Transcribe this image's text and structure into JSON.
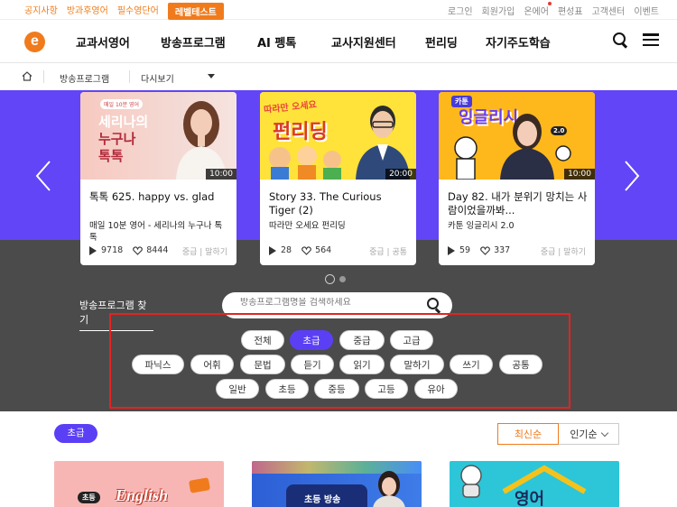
{
  "topbar": {
    "left_links": [
      "공지사항",
      "방과후영어",
      "필수영단어"
    ],
    "level_test": "레벨테스트",
    "right_links": [
      "로그인",
      "회원가입",
      "온에어",
      "편성표",
      "고객센터",
      "이벤트"
    ]
  },
  "nav": {
    "logo": "e",
    "menu": [
      "교과서영어",
      "방송프로그램",
      "AI 펭톡",
      "교사지원센터",
      "펀리딩",
      "자기주도학습"
    ]
  },
  "breadcrumb": {
    "section": "방송프로그램",
    "current": "다시보기"
  },
  "cards": [
    {
      "duration": "10:00",
      "title": "톡톡 625. happy vs. glad",
      "subtitle": "매일 10분 영어 - 세리나의 누구나 톡톡",
      "plays": "9718",
      "likes": "8444",
      "meta": "중급 | 말하기",
      "thumb_text_1": "매일 10분 영어",
      "thumb_text_2": "세리나의",
      "thumb_text_3": "누구나",
      "thumb_text_4": "톡톡"
    },
    {
      "duration": "20:00",
      "title": "Story 33. The Curious Tiger (2)",
      "subtitle": "따라만 오세요 펀리딩",
      "plays": "28",
      "likes": "564",
      "meta": "중급 | 공통",
      "thumb_text_1": "따라만 오세요",
      "thumb_text_2": "펀리딩"
    },
    {
      "duration": "10:00",
      "title": "Day 82. 내가 분위기 망치는 사람이었을까봐...",
      "subtitle": "카툰 잉글리시 2.0",
      "plays": "59",
      "likes": "337",
      "meta": "중급 | 말하기",
      "thumb_text_1": "카툰",
      "thumb_text_2": "잉글리시",
      "thumb_text_3": "2.0"
    }
  ],
  "finder": {
    "label": "방송프로그램 찾기",
    "placeholder": "방송프로그램명을 검색하세요"
  },
  "filters": {
    "levels": [
      "전체",
      "초급",
      "중급",
      "고급"
    ],
    "skills": [
      "파닉스",
      "어휘",
      "문법",
      "듣기",
      "읽기",
      "말하기",
      "쓰기",
      "공통"
    ],
    "targets": [
      "일반",
      "초등",
      "중등",
      "고등",
      "유아"
    ],
    "active": "초급"
  },
  "results": {
    "level_tag": "초급",
    "sort_latest": "최신순",
    "sort_popular": "인기순",
    "thumb1_text": "English",
    "thumb1_badge": "초등",
    "thumb2_text": "초등 방송",
    "thumb3_text": "영어"
  },
  "colors": {
    "brand_orange": "#f07b1d",
    "accent_purple": "#5b3ff5",
    "carousel_bg": "#6145f6",
    "dark_bg": "#4b4b4b",
    "highlight_frame": "#e52222"
  }
}
